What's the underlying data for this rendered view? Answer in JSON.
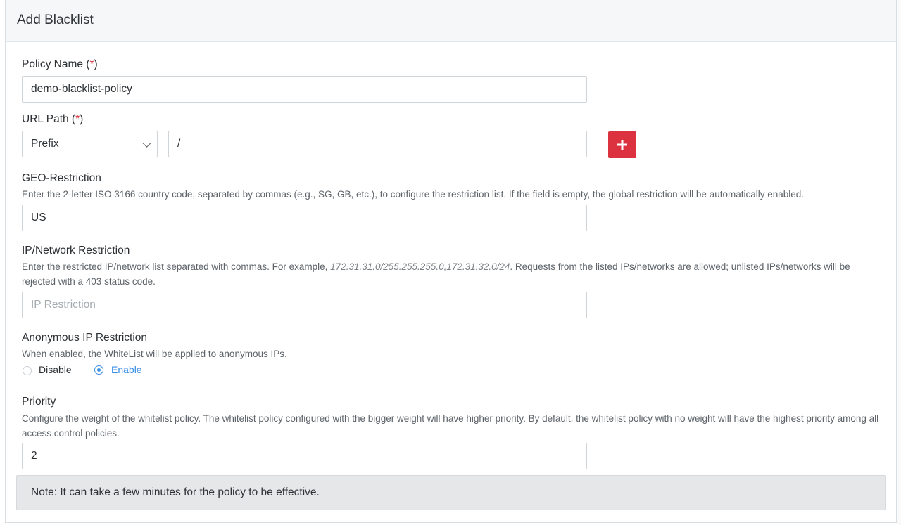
{
  "title": "Add Blacklist",
  "policy_name": {
    "label": "Policy Name (",
    "required_mark": "*",
    "label_end": ")",
    "value": "demo-blacklist-policy"
  },
  "url_path": {
    "label": "URL Path (",
    "required_mark": "*",
    "label_end": ")",
    "match_type": "Prefix",
    "value": "/",
    "add_button_icon": "plus-icon"
  },
  "geo": {
    "label": "GEO-Restriction",
    "description": "Enter the 2-letter ISO 3166 country code, separated by commas (e.g., SG, GB, etc.), to configure the restriction list. If the field is empty, the global restriction will be automatically enabled.",
    "value": "US"
  },
  "ip": {
    "label": "IP/Network Restriction",
    "description_pre": "Enter the restricted IP/network list separated with commas. For example, ",
    "description_example": "172.31.31.0/255.255.255.0,172.31.32.0/24",
    "description_post": ". Requests from the listed IPs/networks are allowed; unlisted IPs/networks will be rejected with a 403 status code.",
    "placeholder": "IP Restriction",
    "value": ""
  },
  "anonymous": {
    "label": "Anonymous IP Restriction",
    "description": "When enabled, the WhiteList will be applied to anonymous IPs.",
    "options": [
      "Disable",
      "Enable"
    ],
    "selected": "Enable"
  },
  "priority": {
    "label": "Priority",
    "description": "Configure the weight of the whitelist policy. The whitelist policy configured with the bigger weight will have higher priority. By default, the whitelist policy with no weight will have the highest priority among all access control policies.",
    "value": "2"
  },
  "note": "Note: It can take a few minutes for the policy to be effective.",
  "colors": {
    "accent_red": "#dc3240",
    "radio_blue": "#3a8ee6",
    "required_red": "#d32f3c"
  }
}
